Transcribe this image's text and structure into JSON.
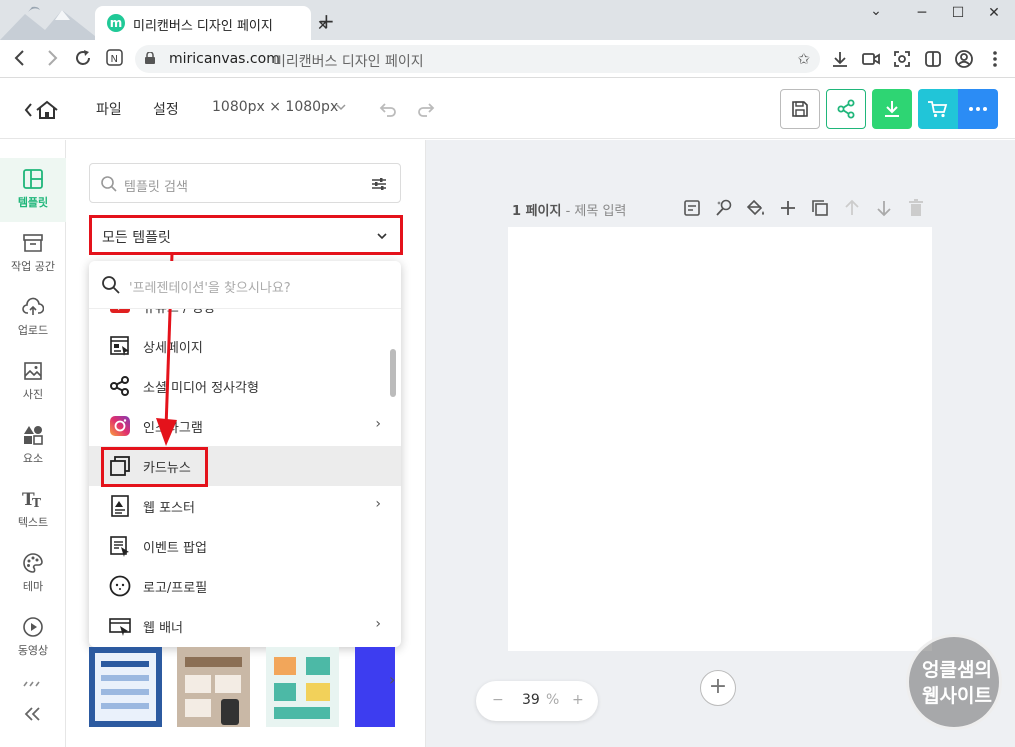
{
  "browser": {
    "tab_title": "미리캔버스 디자인 페이지",
    "favicon_letter": "m",
    "url_host": "miricanvas.com",
    "url_title": "미리캔버스 디자인 페이지",
    "new_tab": "+",
    "close": "✕",
    "minimize": "─",
    "maximize": "☐",
    "chevron": "⌄"
  },
  "header": {
    "menu_file": "파일",
    "menu_settings": "설정",
    "size": "1080px × 1080px",
    "accent": "#1fb67a",
    "download_color": "#2ed573",
    "cart_color": "#21c5d8",
    "more_color": "#2b8cf5"
  },
  "sidebar": {
    "items": [
      {
        "label": "템플릿",
        "icon": "template-icon"
      },
      {
        "label": "작업 공간",
        "icon": "workspace-icon"
      },
      {
        "label": "업로드",
        "icon": "upload-icon"
      },
      {
        "label": "사진",
        "icon": "photo-icon"
      },
      {
        "label": "요소",
        "icon": "elements-icon"
      },
      {
        "label": "텍스트",
        "icon": "text-icon"
      },
      {
        "label": "테마",
        "icon": "theme-icon"
      },
      {
        "label": "동영상",
        "icon": "video-icon"
      }
    ]
  },
  "panel": {
    "search_placeholder": "템플릿 검색",
    "dropdown_value": "모든 템플릿",
    "menu_search_placeholder": "'프레젠테이션'을 찾으시나요?",
    "menu_items": [
      {
        "label": "유튜브 / 영상",
        "icon": "youtube-icon"
      },
      {
        "label": "상세페이지",
        "icon": "detail-page-icon"
      },
      {
        "label": "소셜 미디어 정사각형",
        "icon": "share-nodes-icon"
      },
      {
        "label": "인스타그램",
        "icon": "instagram-icon"
      },
      {
        "label": "카드뉴스",
        "icon": "card-news-icon"
      },
      {
        "label": "웹 포스터",
        "icon": "web-poster-icon"
      },
      {
        "label": "이벤트 팝업",
        "icon": "event-popup-icon"
      },
      {
        "label": "로고/프로필",
        "icon": "logo-profile-icon"
      },
      {
        "label": "웹 배너",
        "icon": "web-banner-icon"
      }
    ]
  },
  "canvas": {
    "page_number": "1 페이지",
    "page_sep": " - ",
    "page_title_placeholder": "제목 입력",
    "zoom_value": "39",
    "zoom_unit": "%",
    "zoom_minus": "−",
    "zoom_plus": "+",
    "add_page": "+"
  },
  "watermark": {
    "line1": "엉클샘의",
    "line2": "웹사이트"
  },
  "annotation_color": "#e4121b"
}
